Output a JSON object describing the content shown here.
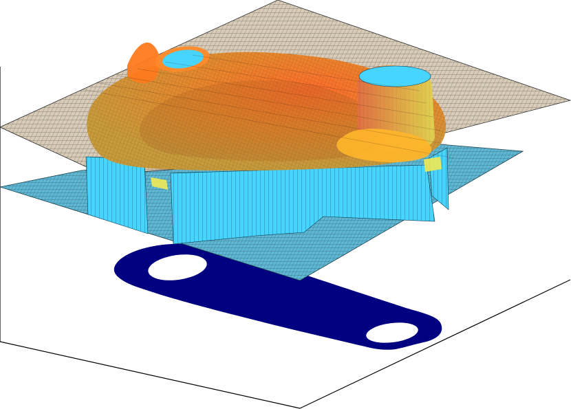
{
  "figure": {
    "kind": "3d-surface-plot",
    "layers": [
      {
        "name": "upper-wireframe-plane",
        "fill": "#d8cbb8",
        "mesh": "#2a2a2a"
      },
      {
        "name": "surface",
        "colormap": [
          "#ffd23a",
          "#ff9a2a",
          "#e8572a",
          "#d43a1f"
        ]
      },
      {
        "name": "lower-wireframe-plane",
        "fill": "#5fb7d3",
        "mesh": "#1c3f4a"
      },
      {
        "name": "vertical-walls",
        "fill": "#47d4ff",
        "mesh": "#0b3a4c"
      },
      {
        "name": "base-shadow",
        "fill": "#000080"
      }
    ],
    "axes_box": {
      "stroke": "#000000",
      "visible": true
    }
  }
}
